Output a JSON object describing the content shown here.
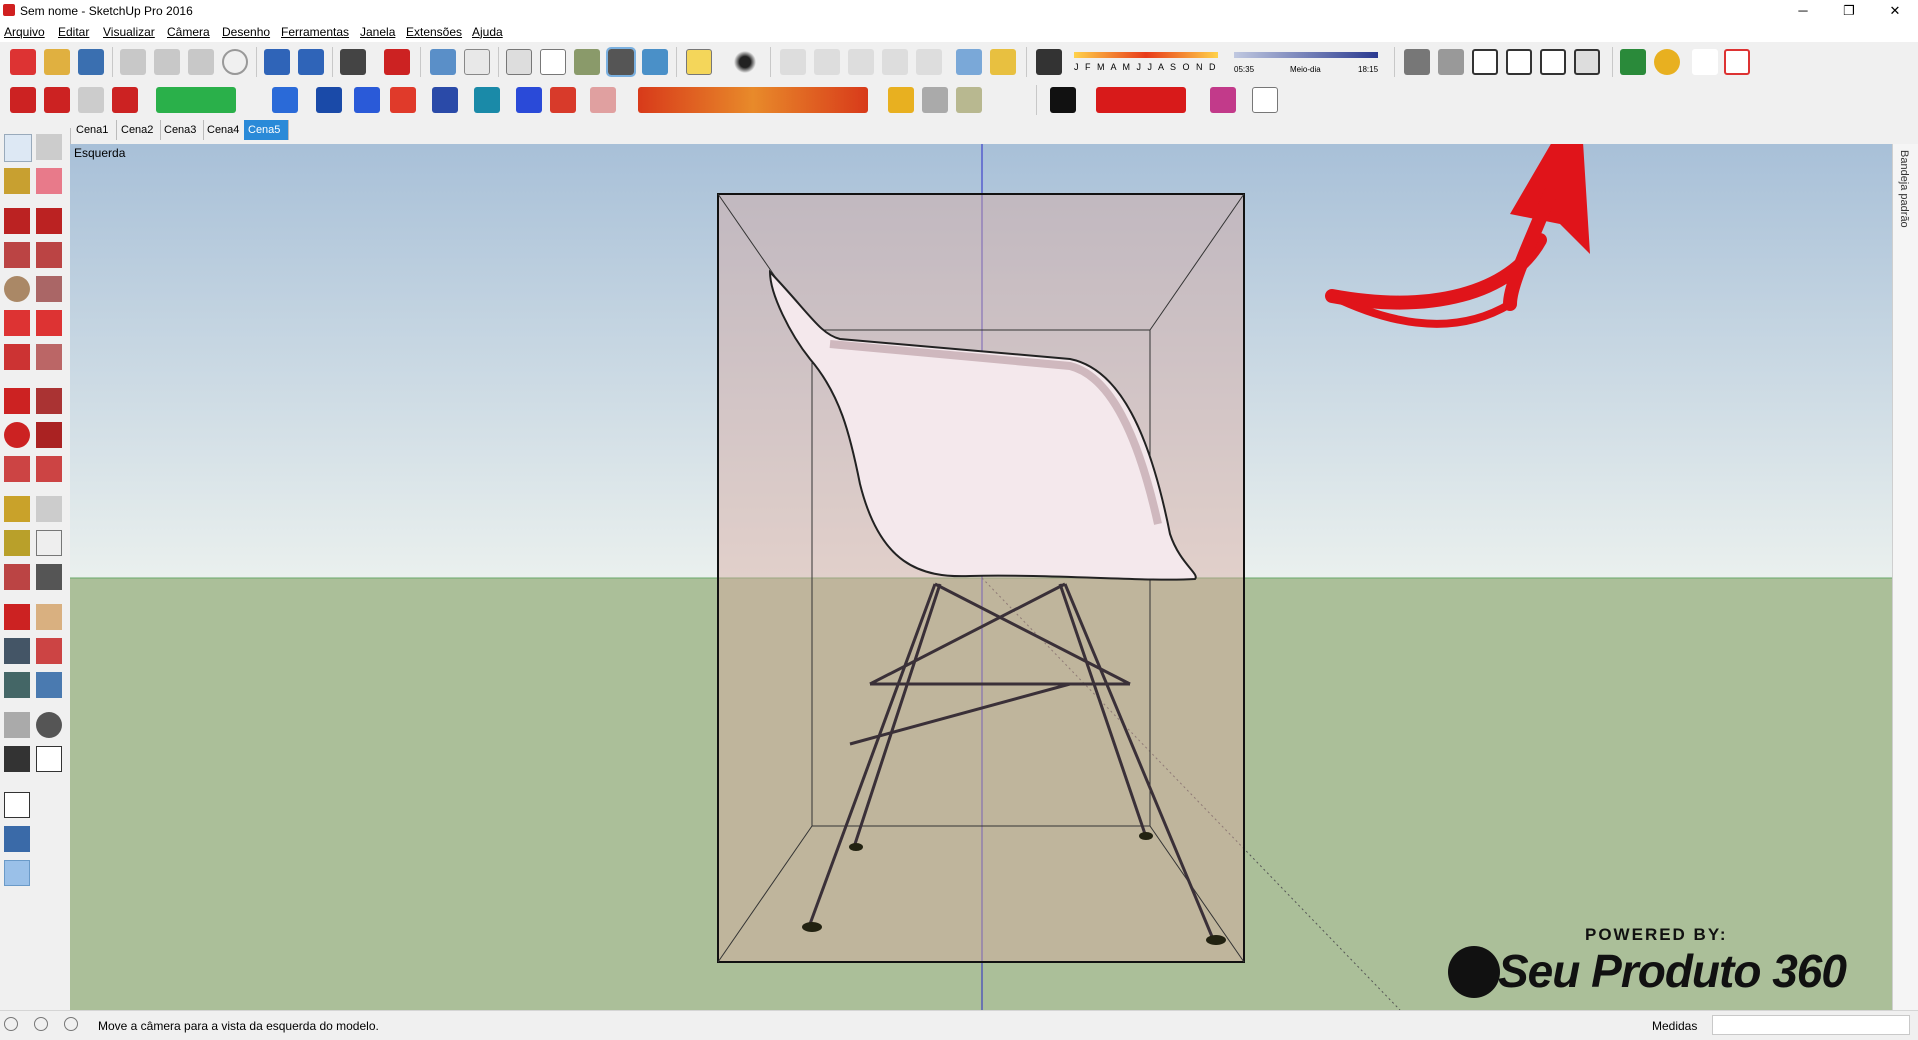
{
  "window": {
    "title": "Sem nome - SketchUp Pro 2016",
    "controls": {
      "minimize": "─",
      "restore": "❐",
      "close": "✕"
    }
  },
  "menu": [
    "Arquivo",
    "Editar",
    "Visualizar",
    "Câmera",
    "Desenho",
    "Ferramentas",
    "Janela",
    "Extensões",
    "Ajuda"
  ],
  "shadow_settings": {
    "months": "J F M A M J J A S O N D",
    "time_start": "05:35",
    "time_mid": "Meio-dia",
    "time_end": "18:15"
  },
  "scenes": {
    "tabs": [
      "Cena1",
      "Cena2",
      "Cena3",
      "Cena4",
      "Cena5"
    ],
    "active_index": 4
  },
  "viewport": {
    "view_label": "Esquerda",
    "colors": {
      "sky_top": "#a8c0d8",
      "sky_bottom": "#eaf0ee",
      "ground": "#abbf99",
      "annotation_arrow": "#e0141a"
    }
  },
  "tray": {
    "label": "Bandeja padrão"
  },
  "status": {
    "message": "Move a câmera para a vista da esquerda do modelo.",
    "measures_label": "Medidas",
    "measures_value": ""
  },
  "watermark": {
    "powered_by": "POWERED BY:",
    "brand": "Seu Produto 360"
  },
  "icons": {
    "toolbar_top": [
      "new-file-icon",
      "open-icon",
      "save-icon",
      "cut-icon",
      "copy-icon",
      "paste-icon",
      "erase-icon",
      "undo-icon",
      "redo-icon",
      "print-icon",
      "model-info-icon",
      "xray-icon",
      "back-edges-icon",
      "wireframe-icon",
      "hidden-line-icon",
      "shaded-icon",
      "shaded-textures-icon",
      "monochrome-icon",
      "section-plane-icon",
      "shadows-icon",
      "iso-view-icon",
      "top-view-icon",
      "front-view-icon",
      "right-view-icon",
      "back-view-icon",
      "left-view-icon",
      "warehouse-icon",
      "extension-warehouse-icon",
      "geo-location-icon",
      "level-icon",
      "layout-icon"
    ],
    "left_tools": [
      "select-icon",
      "component-icon",
      "paint-bucket-icon",
      "eraser-icon",
      "line-icon",
      "freehand-icon",
      "rectangle-icon",
      "rotated-rect-icon",
      "circle-icon",
      "polygon-icon",
      "arc-icon",
      "two-point-arc-icon",
      "three-point-arc-icon",
      "pie-icon",
      "move-icon",
      "push-pull-icon",
      "rotate-icon",
      "follow-me-icon",
      "scale-icon",
      "offset-icon",
      "tape-measure-icon",
      "dimension-icon",
      "protractor-icon",
      "text-icon",
      "axes-icon",
      "3d-text-icon",
      "orbit-icon",
      "pan-icon",
      "zoom-icon",
      "zoom-window-icon",
      "zoom-extents-icon",
      "previous-view-icon",
      "position-camera-icon",
      "look-around-icon",
      "walk-icon",
      "section-icon"
    ]
  }
}
